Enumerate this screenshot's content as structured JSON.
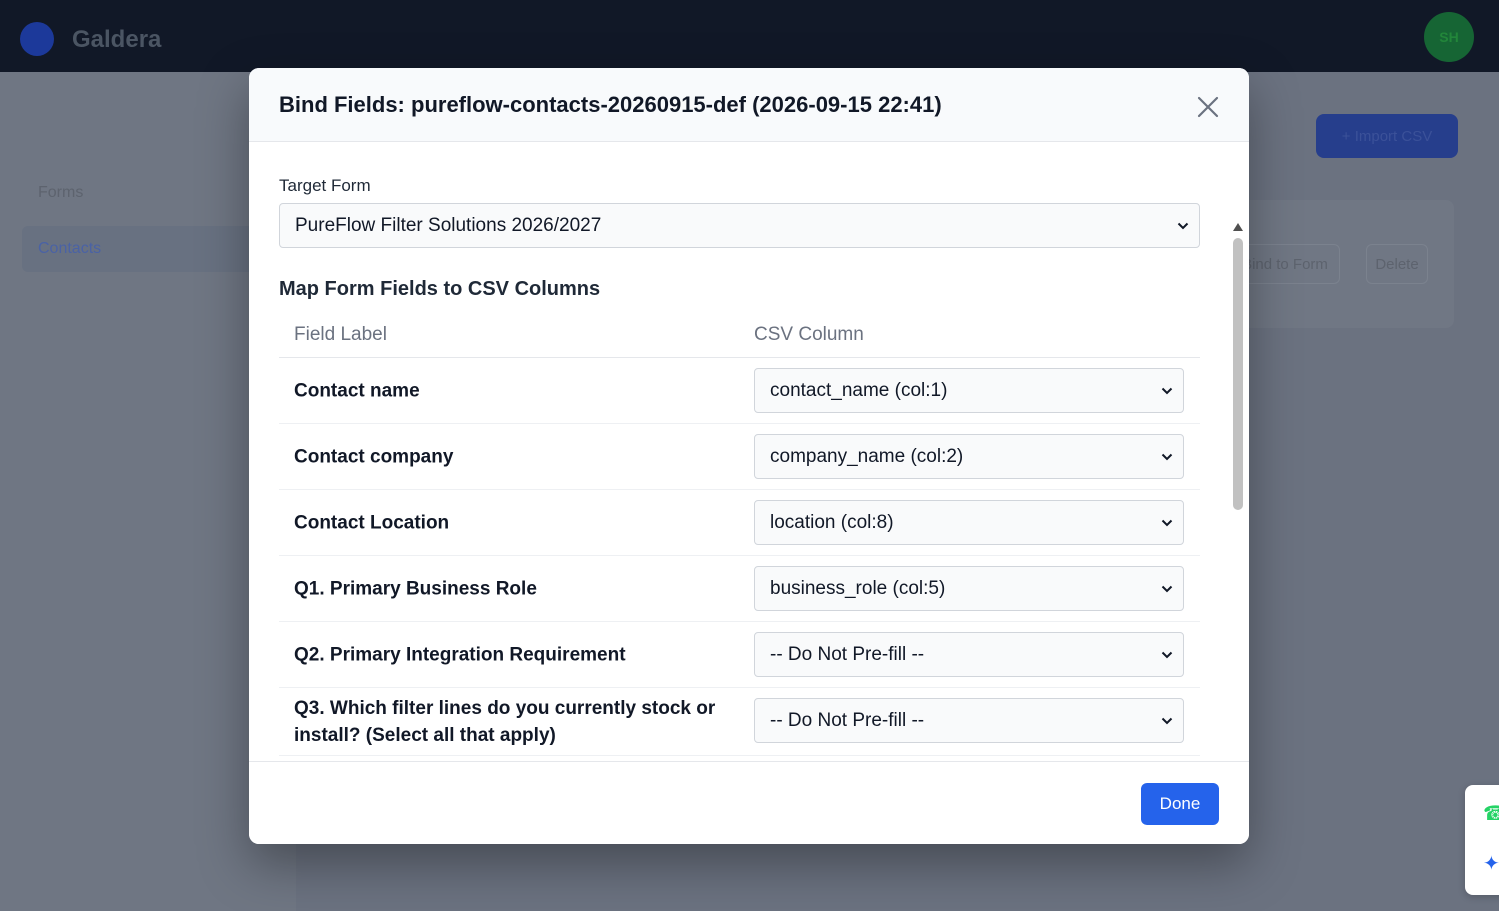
{
  "background": {
    "brand_name": "Galdera",
    "avatar_initials": "SH",
    "sidebar": {
      "items": [
        {
          "label": "Forms"
        },
        {
          "label": "Contacts"
        }
      ]
    },
    "import_label": "+ Import CSV",
    "row_actions": {
      "bind": "Bind to Form",
      "delete": "Delete"
    }
  },
  "modal": {
    "title": "Bind Fields: pureflow-contacts-20260915-def (2026-09-15 22:41)",
    "target_form": {
      "label": "Target Form",
      "selected": "PureFlow Filter Solutions 2026/2027"
    },
    "section_title": "Map Form Fields to CSV Columns",
    "table": {
      "headers": {
        "field_label": "Field Label",
        "csv_column": "CSV Column"
      },
      "rows": [
        {
          "label": "Contact name",
          "selected": "contact_name (col:1)"
        },
        {
          "label": "Contact company",
          "selected": "company_name (col:2)"
        },
        {
          "label": "Contact Location",
          "selected": "location (col:8)"
        },
        {
          "label": "Q1. Primary Business Role",
          "selected": "business_role (col:5)"
        },
        {
          "label": "Q2. Primary Integration Requirement",
          "selected": "-- Do Not Pre-fill --"
        },
        {
          "label": "Q3. Which filter lines do you currently stock or install? (Select all that apply)",
          "selected": "-- Do Not Pre-fill --"
        }
      ]
    },
    "done_label": "Done"
  },
  "colors": {
    "accent": "#2563eb",
    "header_bg": "#111827"
  },
  "icons": {
    "close": "close-icon",
    "chevron": "chevron-down-icon",
    "whatsapp": "whatsapp-icon",
    "assistant": "sparkle-icon"
  }
}
